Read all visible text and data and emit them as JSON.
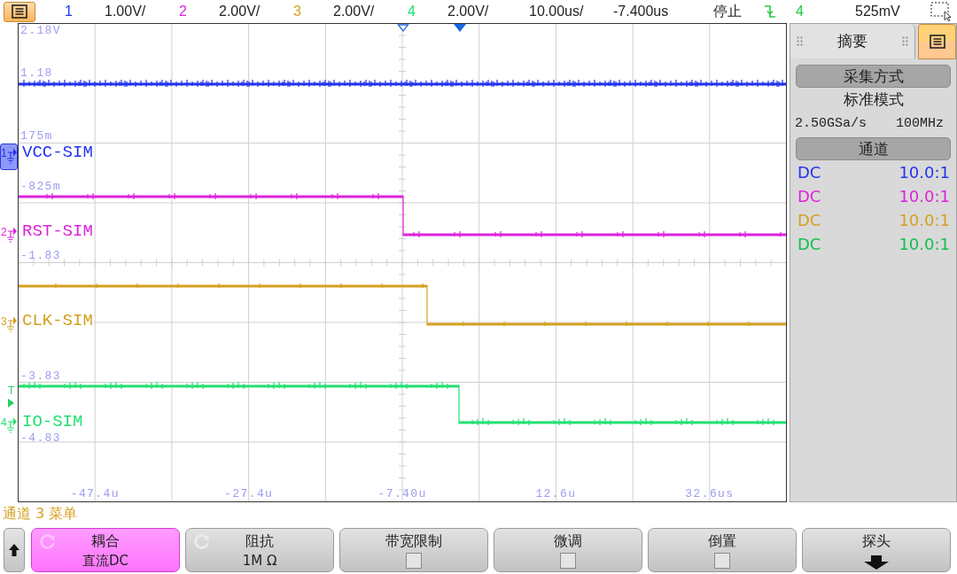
{
  "top_bar": {
    "channel_scales": [
      {
        "channel": "1",
        "scale": "1.00V/",
        "color": "#2233ee"
      },
      {
        "channel": "2",
        "scale": "2.00V/",
        "color": "#dd22dd"
      },
      {
        "channel": "3",
        "scale": "2.00V/",
        "color": "#d4a020"
      },
      {
        "channel": "4",
        "scale": "2.00V/",
        "color": "#22e070"
      }
    ],
    "timebase": "10.00us/",
    "delay": "-7.400us",
    "run_state": "停止",
    "trigger_source": "4",
    "trigger_level": "525mV"
  },
  "display": {
    "y_labels": [
      "2.18V",
      "1.18",
      "175m",
      "-825m",
      "-1.83",
      "-3.83",
      "-4.83"
    ],
    "x_labels": [
      "-47.4u",
      "-27.4u",
      "-7.40u",
      "12.6u",
      "32.6us"
    ],
    "channels": [
      {
        "marker": "1",
        "label": "VCC-SIM",
        "color": "#2233ee",
        "selected": true
      },
      {
        "marker": "2",
        "label": "RST-SIM",
        "color": "#dd22dd",
        "selected": false
      },
      {
        "marker": "3",
        "label": "CLK-SIM",
        "color": "#d4a020",
        "selected": false
      },
      {
        "marker": "4",
        "label": "IO-SIM",
        "color": "#22e070",
        "selected": false
      }
    ],
    "trigger_marker": "T"
  },
  "summary_panel": {
    "tab": "摘要",
    "acquisition": {
      "title": "采集方式",
      "mode": "标准模式",
      "sample_rate": "2.50GSa/s",
      "bandwidth": "100MHz"
    },
    "channels": {
      "title": "通道",
      "rows": [
        {
          "coupling": "DC",
          "probe": "10.0:1",
          "color": "#2233ee"
        },
        {
          "coupling": "DC",
          "probe": "10.0:1",
          "color": "#dd22dd"
        },
        {
          "coupling": "DC",
          "probe": "10.0:1",
          "color": "#d4a020"
        },
        {
          "coupling": "DC",
          "probe": "10.0:1",
          "color": "#10c050"
        }
      ]
    }
  },
  "menu": {
    "title": "通道 3 菜单",
    "softkeys": [
      {
        "kind": "cycle",
        "label": "耦合",
        "value": "直流DC",
        "selected": true
      },
      {
        "kind": "cycle",
        "label": "阻抗",
        "value": "1M Ω",
        "selected": false
      },
      {
        "kind": "checkbox",
        "label": "带宽限制",
        "checked": false,
        "selected": false
      },
      {
        "kind": "checkbox",
        "label": "微调",
        "checked": false,
        "selected": false
      },
      {
        "kind": "checkbox",
        "label": "倒置",
        "checked": false,
        "selected": false
      },
      {
        "kind": "submenu",
        "label": "探头",
        "selected": false
      }
    ]
  }
}
